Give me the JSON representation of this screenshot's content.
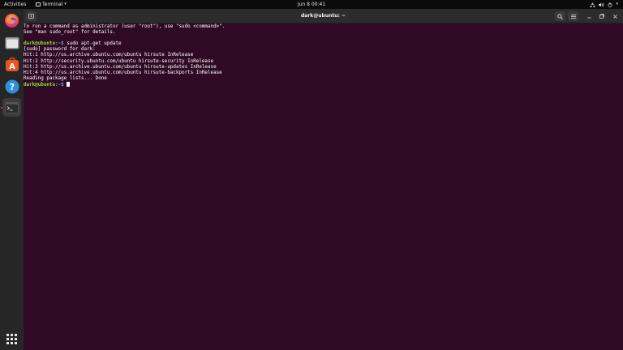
{
  "topbar": {
    "activities": "Activities",
    "app_name": "Terminal",
    "clock": "Jun 8  00:41"
  },
  "dock": {
    "items": [
      {
        "name": "firefox",
        "icon": "firefox-icon"
      },
      {
        "name": "files",
        "icon": "files-icon"
      },
      {
        "name": "software",
        "icon": "software-icon"
      },
      {
        "name": "help",
        "icon": "help-icon"
      },
      {
        "name": "terminal",
        "icon": "terminal-icon",
        "active": true
      },
      {
        "name": "show-applications",
        "icon": "app-grid-icon"
      }
    ]
  },
  "window": {
    "title": "dark@ubuntu: ~"
  },
  "terminal": {
    "lines": [
      {
        "text": "To run a command as administrator (user \"root\"), use \"sudo <command>\"."
      },
      {
        "text": "See \"man sudo_root\" for details."
      },
      {
        "text": ""
      },
      {
        "prompt_user": "dark@ubuntu",
        "prompt_path": ":~$",
        "text": " sudo apt-get update"
      },
      {
        "text": "[sudo] password for dark:"
      },
      {
        "text": "Hit:1 http://us.archive.ubuntu.com/ubuntu hirsute InRelease"
      },
      {
        "text": "Hit:2 http://security.ubuntu.com/ubuntu hirsute-security InRelease"
      },
      {
        "text": "Hit:3 http://us.archive.ubuntu.com/ubuntu hirsute-updates InRelease"
      },
      {
        "text": "Hit:4 http://us.archive.ubuntu.com/ubuntu hirsute-backports InRelease"
      },
      {
        "text": "Reading package lists... Done"
      },
      {
        "prompt_user": "dark@ubuntu",
        "prompt_path": ":~$",
        "text": " ",
        "cursor": true
      }
    ]
  },
  "colors": {
    "terminal_bg": "#300a24",
    "prompt_user": "#8ae234",
    "prompt_path": "#729fcf",
    "accent": "#e95420"
  }
}
